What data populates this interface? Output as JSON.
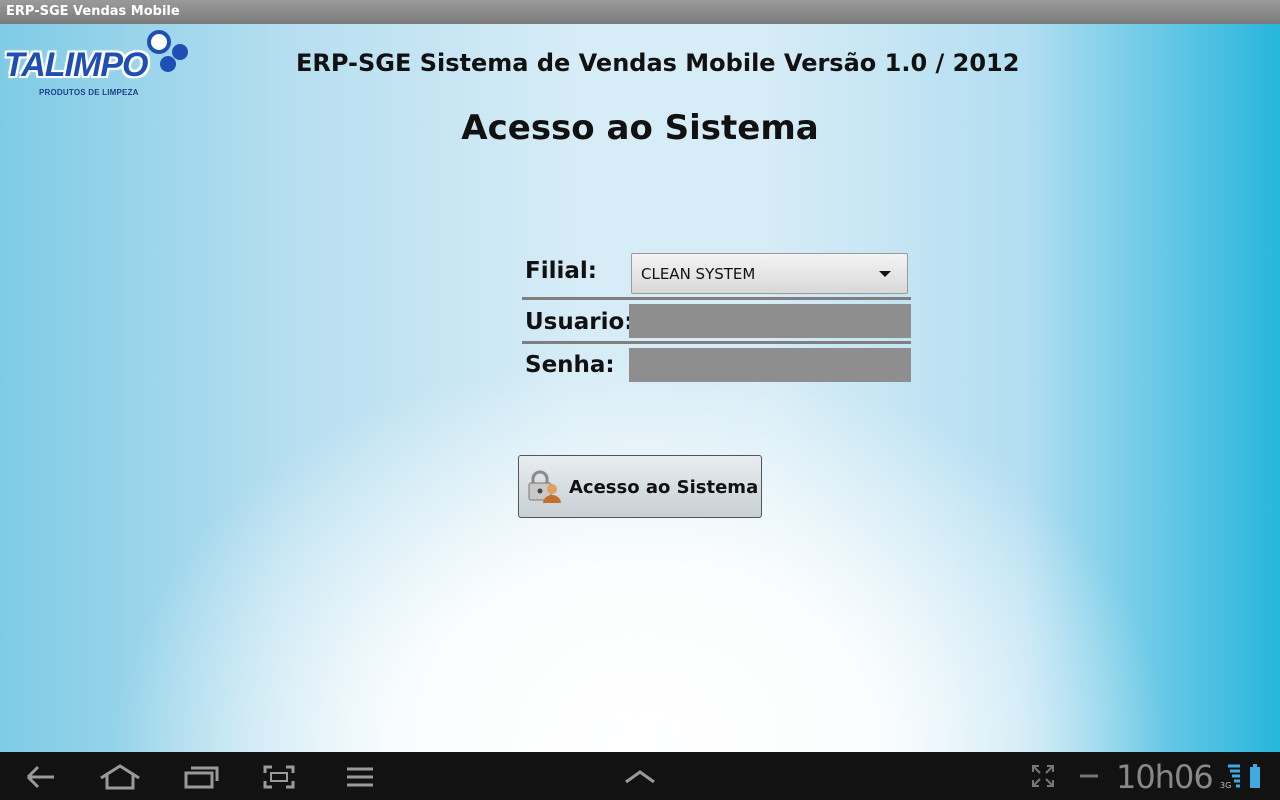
{
  "window": {
    "title": "ERP-SGE Vendas Mobile"
  },
  "logo": {
    "name": "TALIMPO",
    "tagline": "PRODUTOS DE LIMPEZA"
  },
  "header": {
    "app_title": "ERP-SGE Sistema de Vendas Mobile Versão 1.0 / 2012",
    "page_title": "Acesso ao Sistema"
  },
  "form": {
    "filial_label": "Filial:",
    "filial_value": "CLEAN SYSTEM",
    "usuario_label": "Usuario:",
    "usuario_value": "",
    "senha_label": "Senha:",
    "senha_value": ""
  },
  "login_button": {
    "label": "Acesso ao Sistema",
    "icon": "lock-user-icon"
  },
  "navbar": {
    "icons": [
      "back-icon",
      "home-icon",
      "recent-apps-icon",
      "screenshot-icon",
      "menu-icon",
      "up-chevron-icon",
      "fullscreen-icon",
      "minus-icon",
      "signal-3g-icon",
      "battery-icon"
    ],
    "clock": "10h06",
    "network": "3G"
  },
  "colors": {
    "logo_blue": "#1f4fb3",
    "field_gray": "#8e8e8e",
    "navbar": "#121212"
  }
}
